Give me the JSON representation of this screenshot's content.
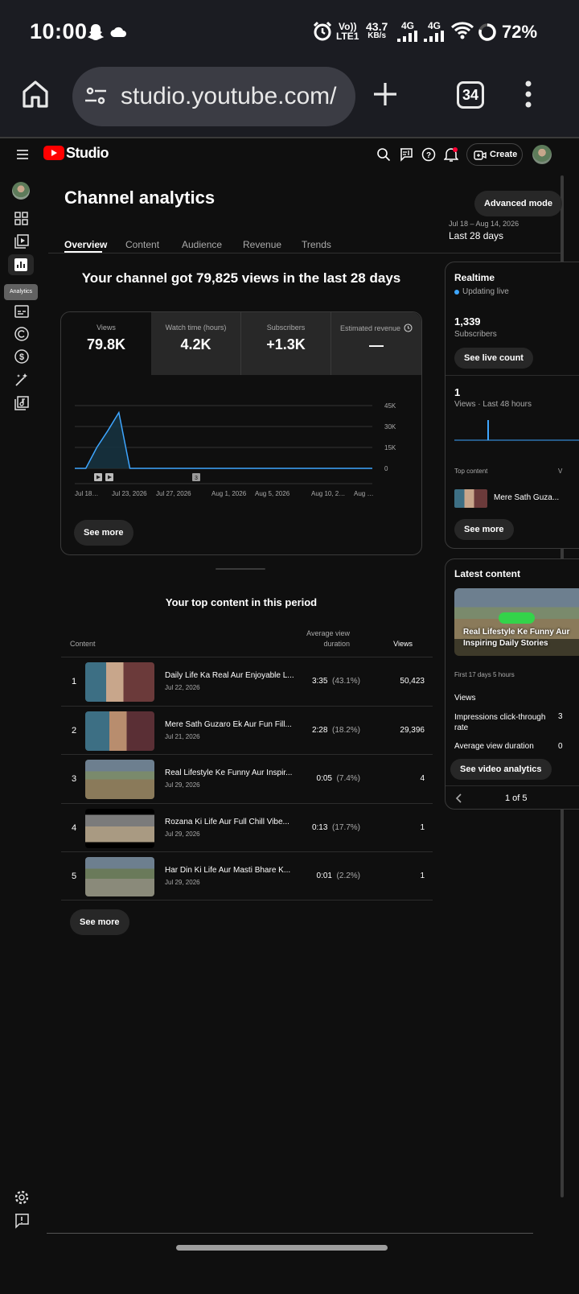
{
  "status_bar": {
    "time": "10:00",
    "network_speed": "43.7",
    "network_unit": "KB/s",
    "volte": "Vo))",
    "lte": "LTE1",
    "net1": "4G",
    "net2": "4G",
    "battery": "72%"
  },
  "browser": {
    "url": "studio.youtube.com/",
    "tab_count": "34"
  },
  "studio_header": {
    "logo_text": "Studio",
    "create_label": "Create"
  },
  "left_rail": {
    "tooltip": "Analytics"
  },
  "page": {
    "title": "Channel analytics",
    "advanced_mode": "Advanced mode",
    "date_range_small": "Jul 18 – Aug 14, 2026",
    "date_range": "Last 28 days",
    "tabs": [
      "Overview",
      "Content",
      "Audience",
      "Revenue",
      "Trends"
    ]
  },
  "overview": {
    "headline": "Your channel got 79,825 views in the last 28 days",
    "metrics": [
      {
        "label": "Views",
        "value": "79.8K"
      },
      {
        "label": "Watch time (hours)",
        "value": "4.2K"
      },
      {
        "label": "Subscribers",
        "value": "+1.3K"
      },
      {
        "label": "Estimated revenue",
        "value": "—"
      }
    ],
    "see_more": "See more",
    "marker_label": "3"
  },
  "chart_data": {
    "type": "area",
    "x": [
      "Jul 18",
      "Jul 19",
      "Jul 20",
      "Jul 21",
      "Jul 22",
      "Jul 23",
      "Jul 24",
      "Aug 14"
    ],
    "x_tick_labels": [
      "Jul 18…",
      "Jul 23, 2026",
      "Jul 27, 2026",
      "Aug 1, 2026",
      "Aug 5, 2026",
      "Aug 10, 2…",
      "Aug …"
    ],
    "y_tick_labels": [
      "45K",
      "30K",
      "15K",
      "0"
    ],
    "series": [
      {
        "values": [
          0,
          0,
          15000,
          27000,
          40000,
          0,
          0,
          0
        ]
      }
    ],
    "ylim": [
      0,
      45000
    ],
    "grid": true,
    "accent": "#3ea6ff"
  },
  "top_content": {
    "heading": "Your top content in this period",
    "col_content": "Content",
    "col_avd": "Average view duration",
    "col_views": "Views",
    "rows": [
      {
        "rank": "1",
        "title": "Daily Life Ka Real Aur Enjoyable L...",
        "date": "Jul 22, 2026",
        "avd": "3:35",
        "avd_pct": "(43.1%)",
        "views": "50,423"
      },
      {
        "rank": "2",
        "title": "Mere Sath Guzaro Ek Aur Fun Fill...",
        "date": "Jul 21, 2026",
        "avd": "2:28",
        "avd_pct": "(18.2%)",
        "views": "29,396"
      },
      {
        "rank": "3",
        "title": "Real Lifestyle Ke Funny Aur Inspir...",
        "date": "Jul 29, 2026",
        "avd": "0:05",
        "avd_pct": "(7.4%)",
        "views": "4"
      },
      {
        "rank": "4",
        "title": "Rozana Ki Life Aur Full Chill Vibe...",
        "date": "Jul 29, 2026",
        "avd": "0:13",
        "avd_pct": "(17.7%)",
        "views": "1"
      },
      {
        "rank": "5",
        "title": "Har Din Ki Life Aur Masti Bhare K...",
        "date": "Jul 29, 2026",
        "avd": "0:01",
        "avd_pct": "(2.2%)",
        "views": "1"
      }
    ],
    "see_more": "See more"
  },
  "realtime": {
    "title": "Realtime",
    "status": "Updating live",
    "subs_value": "1,339",
    "subs_label": "Subscribers",
    "see_live": "See live count",
    "views_value": "1",
    "views_label": "Views · Last 48 hours",
    "top_content_label": "Top content",
    "top_content_col": "V",
    "top_item": "Mere Sath Guza...",
    "see_more": "See more"
  },
  "latest": {
    "title": "Latest content",
    "video_title": "Real Lifestyle Ke Funny Aur Inspiring Daily Stories",
    "first_period": "First 17 days 5 hours",
    "views_label": "Views",
    "ctr_label": "Impressions click-through rate",
    "ctr_value": "3",
    "avd_label": "Average view duration",
    "avd_value": "0",
    "see_analytics": "See video analytics",
    "pager": "1 of 5"
  }
}
